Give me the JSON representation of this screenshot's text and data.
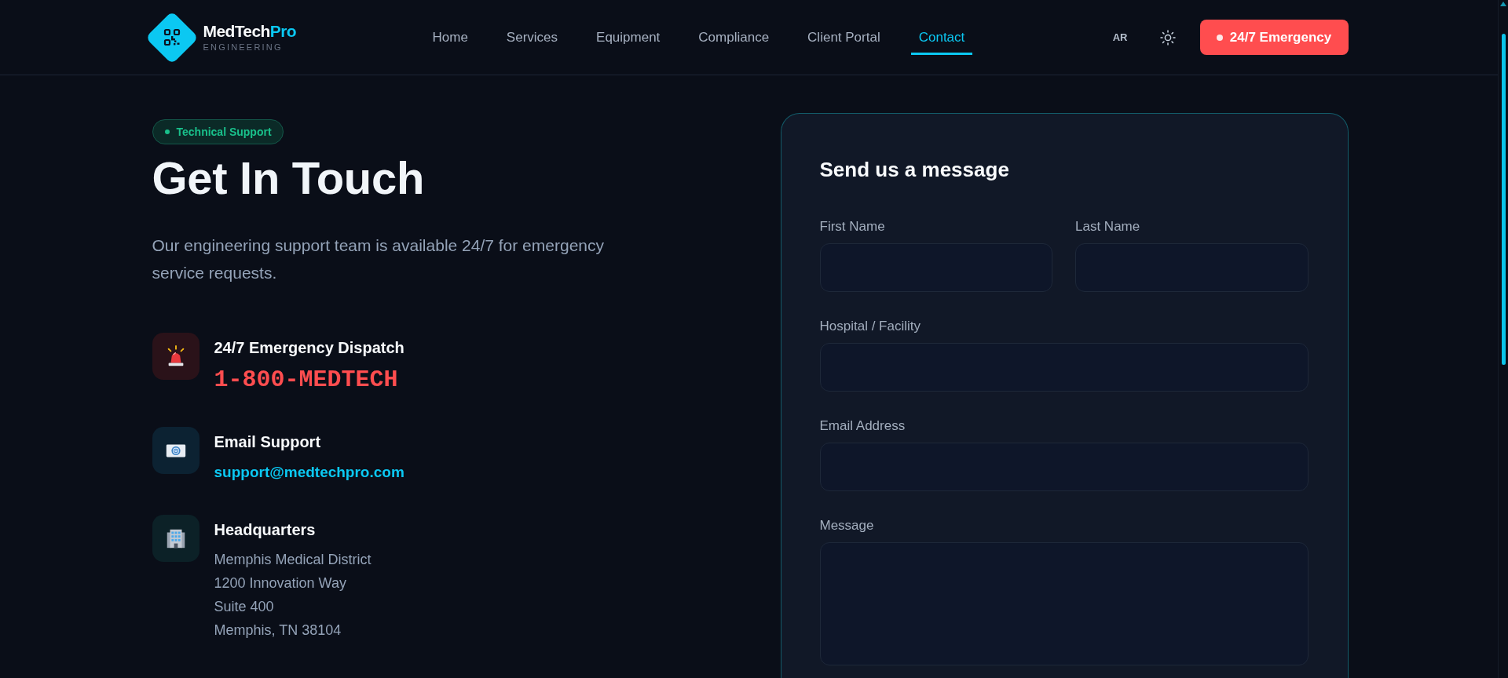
{
  "header": {
    "brand": {
      "name": "MedTech",
      "accent": "Pro",
      "tagline": "ENGINEERING"
    },
    "nav": [
      {
        "label": "Home",
        "selected": false
      },
      {
        "label": "Services",
        "selected": false
      },
      {
        "label": "Equipment",
        "selected": false
      },
      {
        "label": "Compliance",
        "selected": false
      },
      {
        "label": "Client Portal",
        "selected": false
      },
      {
        "label": "Contact",
        "selected": true
      }
    ],
    "language": "AR",
    "emergency_button": "24/7 Emergency"
  },
  "hero": {
    "badge": "Technical Support",
    "title": "Get In Touch",
    "intro": "Our engineering support team is available 24/7 for emergency service requests."
  },
  "contacts": [
    {
      "kind": "phone",
      "title": "24/7 Emergency Dispatch",
      "value": "1-800-MEDTECH"
    },
    {
      "kind": "email",
      "title": "Email Support",
      "value": "support@medtechpro.com"
    },
    {
      "kind": "address",
      "title": "Headquarters",
      "lines": [
        "Memphis Medical District",
        "1200 Innovation Way",
        "Suite 400",
        "Memphis, TN 38104"
      ]
    }
  ],
  "form": {
    "title": "Send us a message",
    "fields": [
      {
        "label": "First Name",
        "kind": "half"
      },
      {
        "label": "Last Name",
        "kind": "half"
      },
      {
        "label": "Hospital / Facility",
        "kind": "full"
      },
      {
        "label": "Email Address",
        "kind": "full"
      },
      {
        "label": "Message",
        "kind": "textarea"
      }
    ]
  }
}
